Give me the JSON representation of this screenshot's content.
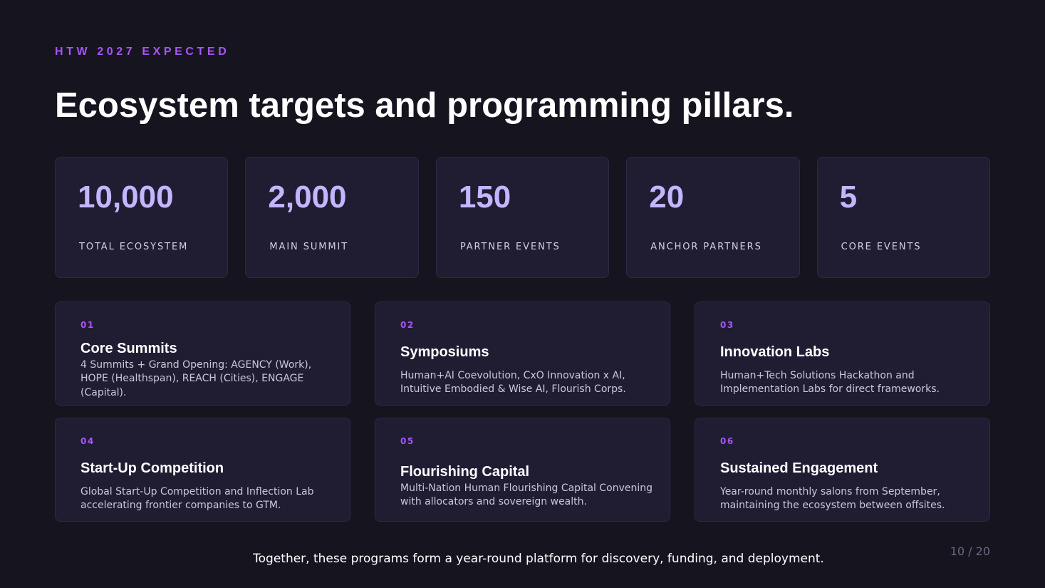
{
  "header": {
    "eyebrow": "HTW 2027 EXPECTED",
    "title": "Ecosystem targets and programming pillars."
  },
  "stats": [
    {
      "value": "10,000",
      "label": "TOTAL ECOSYSTEM"
    },
    {
      "value": "2,000",
      "label": "MAIN SUMMIT"
    },
    {
      "value": "150",
      "label": "PARTNER EVENTS"
    },
    {
      "value": "20",
      "label": "ANCHOR PARTNERS"
    },
    {
      "value": "5",
      "label": "CORE EVENTS"
    }
  ],
  "pillars": [
    {
      "number": "01",
      "title": "Core Summits",
      "description": "4 Summits + Grand Opening: AGENCY (Work), HOPE (Healthspan), REACH (Cities), ENGAGE (Capital)."
    },
    {
      "number": "02",
      "title": "Symposiums",
      "description": "Human+AI Coevolution, CxO Innovation x AI, Intuitive Embodied & Wise AI, Flourish Corps."
    },
    {
      "number": "03",
      "title": "Innovation Labs",
      "description": "Human+Tech Solutions Hackathon and Implementation Labs for direct frameworks."
    },
    {
      "number": "04",
      "title": "Start-Up Competition",
      "description": "Global Start-Up Competition and Inflection Lab accelerating frontier companies to GTM."
    },
    {
      "number": "05",
      "title": "Flourishing Capital",
      "description": "Multi-Nation Human Flourishing Capital Convening with allocators and sovereign wealth."
    },
    {
      "number": "06",
      "title": "Sustained Engagement",
      "description": "Year-round monthly salons from September, maintaining the ecosystem between offsites."
    }
  ],
  "footer": {
    "text": "Together, these programs form a year-round platform for discovery, funding, and deployment.",
    "page": "10 / 20"
  },
  "colors": {
    "background": "#16141f",
    "card": "#201d33",
    "accent": "#a855f7",
    "stat_value": "#c4b5fd"
  }
}
